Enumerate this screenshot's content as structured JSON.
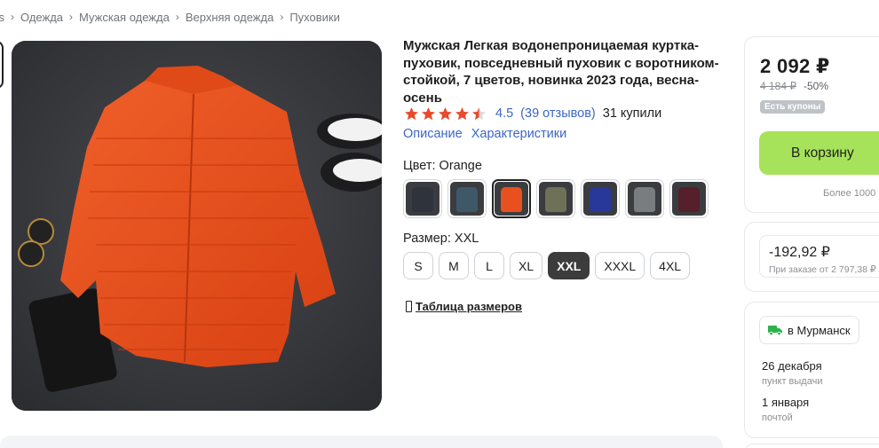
{
  "breadcrumb": [
    "ss",
    "Одежда",
    "Мужская одежда",
    "Верхняя одежда",
    "Пуховики"
  ],
  "product": {
    "title": "Мужская Легкая водонепроницаемая куртка-пуховик, повседневный пуховик с воротником-стойкой, 7 цветов, новинка 2023 года, весна-осень",
    "rating": "4.5",
    "rating_value": 4.5,
    "reviews": "(39 отзывов)",
    "bought": "31 купили",
    "links": [
      "Описание",
      "Характеристики"
    ]
  },
  "color": {
    "label": "Цвет: Orange",
    "options": [
      {
        "name": "dark-gray",
        "color": "#2f343c"
      },
      {
        "name": "blue-gray",
        "color": "#3e5868"
      },
      {
        "name": "orange",
        "color": "#e8501e",
        "selected": true
      },
      {
        "name": "olive",
        "color": "#6e7058"
      },
      {
        "name": "royal-blue",
        "color": "#27389a"
      },
      {
        "name": "gray",
        "color": "#7a7d80"
      },
      {
        "name": "burgundy",
        "color": "#55202a"
      }
    ]
  },
  "size": {
    "label": "Размер: XXL",
    "options": [
      "S",
      "M",
      "L",
      "XL",
      "XXL",
      "XXXL",
      "4XL"
    ],
    "selected": "XXL"
  },
  "size_table": "Таблица размеров",
  "buy": {
    "price": "2 092 ₽",
    "old_price": "4 184 ₽",
    "discount": "-50%",
    "coupon": "Есть купоны",
    "cart_button": "В корзину",
    "more": "Более 1000"
  },
  "bonus": {
    "amount": "-192,92 ₽",
    "condition": "При заказе от 2 797,38 ₽"
  },
  "delivery": {
    "city": "в Мурманск",
    "options": [
      {
        "date": "26 декабря",
        "type": "пункт выдачи"
      },
      {
        "date": "1 января",
        "type": "почтой"
      }
    ]
  },
  "colors": {
    "link": "#3b67c4",
    "star": "#e84a2c",
    "cart": "#a7e35a",
    "accent_dark": "#3c3c3c",
    "jacket": "#e8501e"
  }
}
